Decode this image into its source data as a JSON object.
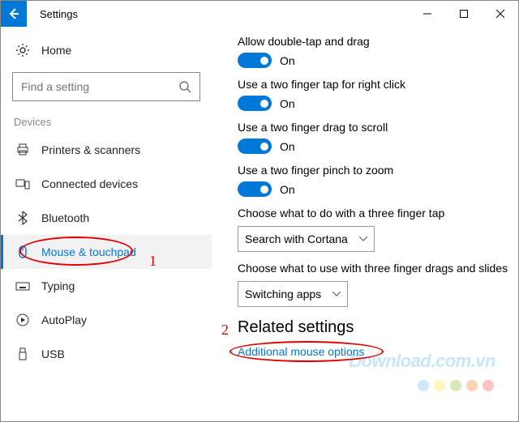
{
  "window": {
    "title": "Settings",
    "controls": {
      "minimize": "—",
      "maximize": "▢",
      "close": "✕"
    }
  },
  "sidebar": {
    "home_label": "Home",
    "search_placeholder": "Find a setting",
    "section_label": "Devices",
    "items": [
      {
        "label": "Printers & scanners"
      },
      {
        "label": "Connected devices"
      },
      {
        "label": "Bluetooth"
      },
      {
        "label": "Mouse & touchpad"
      },
      {
        "label": "Typing"
      },
      {
        "label": "AutoPlay"
      },
      {
        "label": "USB"
      }
    ]
  },
  "settings": {
    "toggle_on": "On",
    "double_tap": {
      "label": "Allow double-tap and drag"
    },
    "two_finger_right": {
      "label": "Use a two finger tap for right click"
    },
    "two_finger_scroll": {
      "label": "Use a two finger drag to scroll"
    },
    "two_finger_zoom": {
      "label": "Use a two finger pinch to zoom"
    },
    "three_tap": {
      "label": "Choose what to do with a three finger tap",
      "value": "Search with Cortana"
    },
    "three_drag": {
      "label": "Choose what to use with three finger drags and slides",
      "value": "Switching apps"
    }
  },
  "related": {
    "heading": "Related settings",
    "link": "Additional mouse options"
  },
  "annotations": {
    "one": "1",
    "two": "2"
  },
  "watermark": {
    "text": "Download.com.vn"
  },
  "dot_colors": [
    "#cfe9fb",
    "#fff6b9",
    "#d7e9bb",
    "#ffd3b3",
    "#ffc1c3"
  ]
}
